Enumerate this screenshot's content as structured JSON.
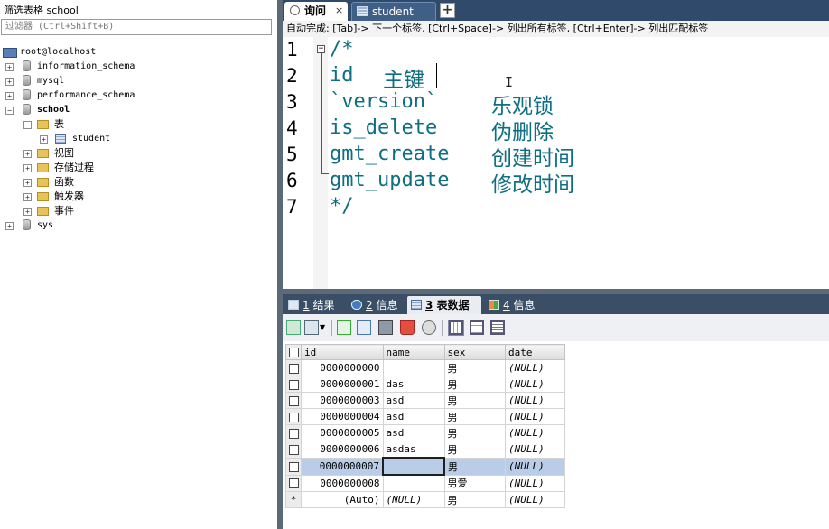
{
  "left_panel": {
    "filter_label": "筛选表格 school",
    "filter_placeholder": "过滤器 (Ctrl+Shift+B)",
    "server": "root@localhost",
    "databases": [
      {
        "name": "information_schema"
      },
      {
        "name": "mysql"
      },
      {
        "name": "performance_schema"
      },
      {
        "name": "school"
      },
      {
        "name": "sys"
      }
    ],
    "school_children": {
      "tables_folder": "表",
      "student_table": "student",
      "views": "视图",
      "procedures": "存储过程",
      "functions": "函数",
      "triggers": "触发器",
      "events": "事件"
    }
  },
  "editor_tabs": {
    "query_label": "询问",
    "close_glyph": "×",
    "student_label": "student",
    "add_glyph": "+"
  },
  "hint_bar": "自动完成: [Tab]-> 下一个标签, [Ctrl+Space]-> 列出所有标签, [Ctrl+Enter]-> 列出匹配标签",
  "editor": {
    "line_numbers": [
      "1",
      "2",
      "3",
      "4",
      "5",
      "6",
      "7"
    ],
    "lines": [
      {
        "code": "/*",
        "note": ""
      },
      {
        "code": "id",
        "note": "主键"
      },
      {
        "code": "`version`",
        "note": "乐观锁"
      },
      {
        "code": "is_delete",
        "note": "伪删除"
      },
      {
        "code": "gmt_create",
        "note": "创建时间"
      },
      {
        "code": "gmt_update",
        "note": "修改时间"
      },
      {
        "code": "*/",
        "note": ""
      }
    ],
    "fold_glyph": "−",
    "ibeam_glyph": "I"
  },
  "result_tabs": [
    {
      "num": "1",
      "label": "结果"
    },
    {
      "num": "2",
      "label": "信息"
    },
    {
      "num": "3",
      "label": "表数据"
    },
    {
      "num": "4",
      "label": "信息"
    }
  ],
  "grid": {
    "columns": [
      "id",
      "name",
      "sex",
      "date"
    ],
    "rows": [
      {
        "id": "0000000000",
        "name": "",
        "sex": "男",
        "date": "(NULL)"
      },
      {
        "id": "0000000001",
        "name": "das",
        "sex": "男",
        "date": "(NULL)"
      },
      {
        "id": "0000000003",
        "name": "asd",
        "sex": "男",
        "date": "(NULL)"
      },
      {
        "id": "0000000004",
        "name": "asd",
        "sex": "男",
        "date": "(NULL)"
      },
      {
        "id": "0000000005",
        "name": "asd",
        "sex": "男",
        "date": "(NULL)"
      },
      {
        "id": "0000000006",
        "name": "asdas",
        "sex": "男",
        "date": "(NULL)"
      },
      {
        "id": "0000000007",
        "name": "",
        "sex": "男",
        "date": "(NULL)"
      },
      {
        "id": "0000000008",
        "name": "",
        "sex": "男爱",
        "date": "(NULL)"
      }
    ],
    "new_row": {
      "marker": "*",
      "id": "(Auto)",
      "name": "(NULL)",
      "sex": "男",
      "date": "(NULL)"
    }
  },
  "colors": {
    "code": "#0e6e82",
    "tab_bar": "#2f4a6b",
    "selection": "#b9cde8"
  }
}
